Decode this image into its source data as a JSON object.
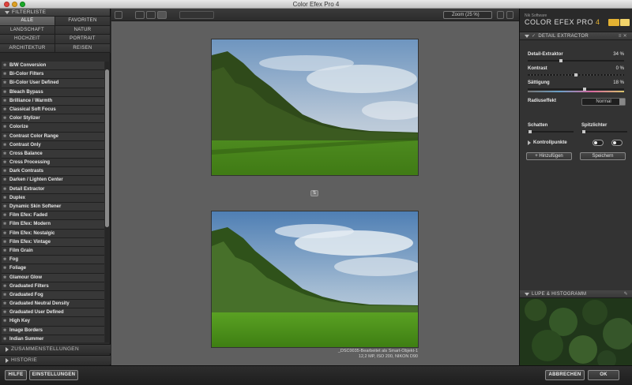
{
  "window": {
    "title": "Color Efex Pro 4"
  },
  "left_panel": {
    "header": "FILTERLISTE",
    "categories": [
      {
        "label": "ALLE",
        "active": true
      },
      {
        "label": "FAVORITEN",
        "active": false
      },
      {
        "label": "LANDSCHAFT",
        "active": false
      },
      {
        "label": "NATUR",
        "active": false
      },
      {
        "label": "HOCHZEIT",
        "active": false
      },
      {
        "label": "PORTRAIT",
        "active": false
      },
      {
        "label": "ARCHITEKTUR",
        "active": false
      },
      {
        "label": "REISEN",
        "active": false
      }
    ],
    "filters": [
      "B/W Conversion",
      "Bi-Color Filters",
      "Bi-Color User Defined",
      "Bleach Bypass",
      "Brilliance / Warmth",
      "Classical Soft Focus",
      "Color Stylizer",
      "Colorize",
      "Contrast Color Range",
      "Contrast Only",
      "Cross Balance",
      "Cross Processing",
      "Dark Contrasts",
      "Darken / Lighten Center",
      "Detail Extractor",
      "Duplex",
      "Dynamic Skin Softener",
      "Film Efex: Faded",
      "Film Efex: Modern",
      "Film Efex: Nostalgic",
      "Film Efex: Vintage",
      "Film Grain",
      "Fog",
      "Foliage",
      "Glamour Glow",
      "Graduated Filters",
      "Graduated Fog",
      "Graduated Neutral Density",
      "Graduated User Defined",
      "High Key",
      "Image Borders",
      "Indian Summer"
    ],
    "sections": {
      "recipes": "ZUSAMMENSTELLUNGEN",
      "history": "HISTORIE"
    }
  },
  "toolbar": {
    "zoom_label": "Zoom (25 %)"
  },
  "preview": {
    "filename": "_DSC0035-Bearbeitet als Smart-Objekt-1",
    "meta": "12,2 MP, ISO 200, NIKON D90"
  },
  "right_panel": {
    "brand_small": "Nik Software",
    "brand_name": "COLOR EFEX PRO",
    "brand_version": "4",
    "filter_header": "DETAIL EXTRACTOR",
    "sliders": [
      {
        "label": "Detail-Extraktor",
        "value": "34",
        "unit": "%",
        "level": 0.34
      },
      {
        "label": "Kontrast",
        "value": "0",
        "unit": "%",
        "level": 0.5
      },
      {
        "label": "Sättigung",
        "value": "18",
        "unit": "%",
        "level": 0.59
      }
    ],
    "radius_label": "Radiuseffekt",
    "radius_value": "Normal",
    "shadows_label": "Schatten",
    "highlights_label": "Spitzlichter",
    "control_points_label": "Kontrollpunkte",
    "add_button": "+ Hinzufügen",
    "save_button": "Speichern",
    "loupe_header": "LUPE & HISTOGRAMM"
  },
  "bottom": {
    "help": "HILFE",
    "settings": "EINSTELLUNGEN",
    "cancel": "ABBRECHEN",
    "ok": "OK"
  },
  "colors": {
    "brand_accent": "#e4b232",
    "panel": "#333333",
    "canvas": "#5f5f5f"
  }
}
